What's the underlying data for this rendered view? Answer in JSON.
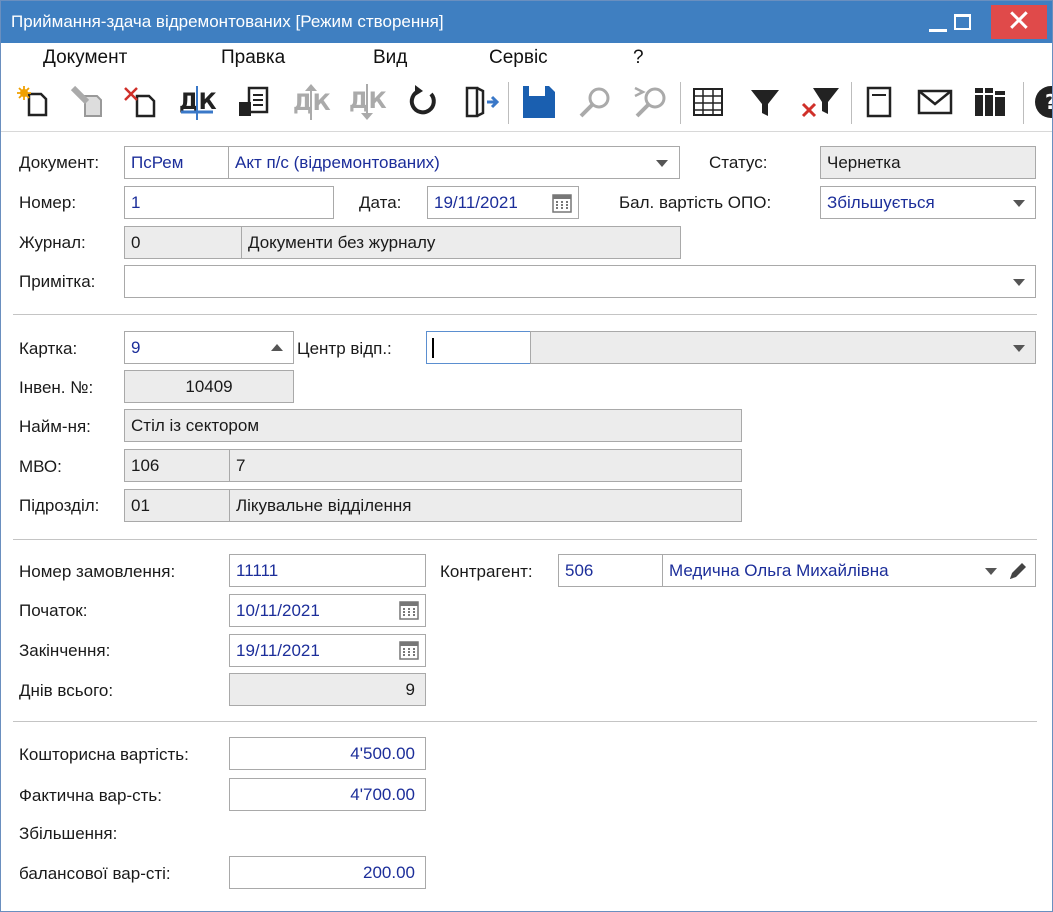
{
  "window": {
    "title": "Приймання-здача відремонтованих [Режим створення]"
  },
  "menu": [
    "Документ",
    "Правка",
    "Вид",
    "Сервіс",
    "?"
  ],
  "toolbar_icons": [
    "new-doc-icon",
    "edit-doc-icon",
    "delete-doc-icon",
    "dk-icon",
    "print-doc-icon",
    "dk-up-icon",
    "dk-down-icon",
    "refresh-icon",
    "exit-icon",
    "save-icon",
    "find-icon",
    "find-next-icon",
    "grid-icon",
    "filter-icon",
    "clear-filter-icon",
    "notepad-icon",
    "mail-icon",
    "books-icon",
    "help-icon"
  ],
  "header": {
    "document_label": "Документ:",
    "document_code": "ПсРем",
    "document_name": "Акт п/с (відремонтованих)",
    "status_label": "Статус:",
    "status_value": "Чернетка",
    "number_label": "Номер:",
    "number_value": "1",
    "date_label": "Дата:",
    "date_value": "19/11/2021",
    "balance_label": "Бал. вартість ОПО:",
    "balance_value": "Збільшується",
    "journal_label": "Журнал:",
    "journal_code": "0",
    "journal_name": "Документи без журналу",
    "note_label": "Примітка:",
    "note_value": ""
  },
  "card": {
    "card_label": "Картка:",
    "card_value": "9",
    "center_label": "Центр відп.:",
    "center_value": "",
    "inv_label": "Інвен. №:",
    "inv_value": "10409",
    "name_label": "Найм-ня:",
    "name_value": "Стіл із сектором",
    "mvo_label": "МВО:",
    "mvo_code": "106",
    "mvo_name": "7",
    "dept_label": "Підрозділ:",
    "dept_code": "01",
    "dept_name": "Лікувальне відділення"
  },
  "order": {
    "order_label": "Номер замовлення:",
    "order_value": "11111",
    "contractor_label": "Контрагент:",
    "contractor_code": "506",
    "contractor_name": "Медична Ольга Михайлівна",
    "start_label": "Початок:",
    "start_value": "10/11/2021",
    "end_label": "Закінчення:",
    "end_value": "19/11/2021",
    "days_label": "Днів всього:",
    "days_value": "9"
  },
  "costs": {
    "estimate_label": "Кошторисна вартість:",
    "estimate_value": "4'500.00",
    "actual_label": "Фактична вар-сть:",
    "actual_value": "4'700.00",
    "increase_label": "Збільшення:",
    "balance_inc_label": "балансової вар-сті:",
    "balance_inc_value": "200.00"
  },
  "colors": {
    "titlebar": "#3f7fc1",
    "close": "#e04a4a",
    "value_text": "#1c2e9a",
    "readonly_bg": "#ececec"
  }
}
